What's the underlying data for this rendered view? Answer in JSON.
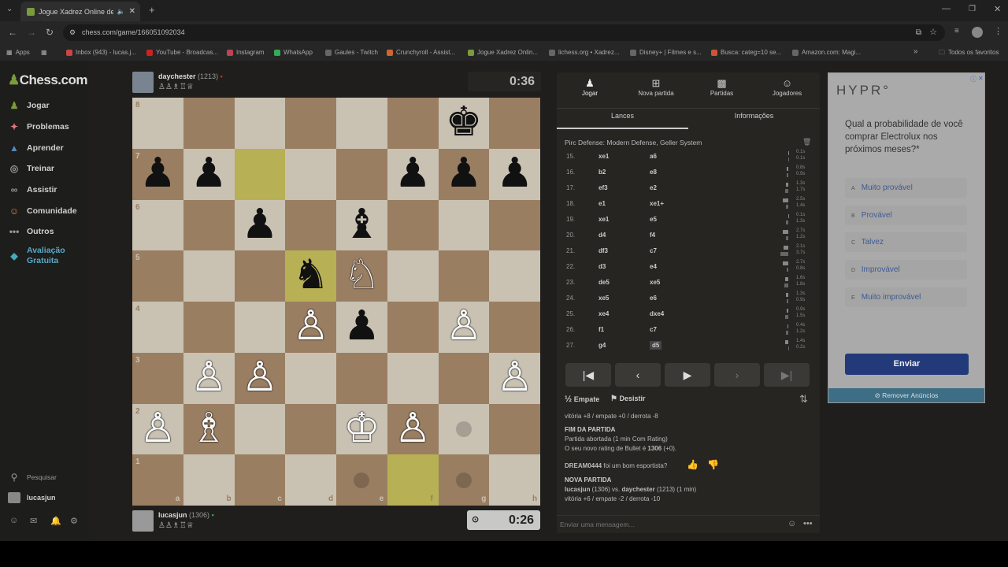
{
  "browser": {
    "tab_title": "Jogue Xadrez Online de Gr...",
    "url": "chess.com/game/166051092034",
    "bookmarks": [
      "Apps",
      "Inbox (943) - lucas.j...",
      "YouTube - Broadcas...",
      "Instagram",
      "WhatsApp",
      "Gaules - Twitch",
      "Crunchyroll - Assist...",
      "Jogue Xadrez Onlin...",
      "lichess.org • Xadrez...",
      "Disney+ | Filmes e s...",
      "Busca: categ=10 se...",
      "Amazon.com: Magi..."
    ],
    "bookmarks_folder": "Todos os favoritos"
  },
  "sidebar": {
    "logo": "Chess.com",
    "items": [
      {
        "label": "Jogar",
        "icon": "pawn-icon"
      },
      {
        "label": "Problemas",
        "icon": "puzzle-icon"
      },
      {
        "label": "Aprender",
        "icon": "graduation-icon"
      },
      {
        "label": "Treinar",
        "icon": "target-icon"
      },
      {
        "label": "Assistir",
        "icon": "binoculars-icon"
      },
      {
        "label": "Comunidade",
        "icon": "people-icon"
      },
      {
        "label": "Outros",
        "icon": "more-icon"
      },
      {
        "label": "Avaliação Gratuita",
        "icon": "diamond-icon"
      }
    ],
    "search_label": "Pesquisar",
    "user_label": "lucasjun"
  },
  "top_player": {
    "name": "daychester",
    "rating": "(1213)",
    "clock": "0:36"
  },
  "bottom_player": {
    "name": "lucasjun",
    "rating": "(1306)",
    "clock": "0:26"
  },
  "board": {
    "files": [
      "a",
      "b",
      "c",
      "d",
      "e",
      "f",
      "g",
      "h"
    ],
    "ranks": [
      "8",
      "7",
      "6",
      "5",
      "4",
      "3",
      "2",
      "1"
    ],
    "highlights": [
      "c7",
      "d5",
      "f1"
    ],
    "move_hints": [
      "g2",
      "e1",
      "g1"
    ],
    "pieces": [
      {
        "sq": "g8",
        "glyph": "♚",
        "color": "b"
      },
      {
        "sq": "a7",
        "glyph": "♟",
        "color": "b"
      },
      {
        "sq": "b7",
        "glyph": "♟",
        "color": "b"
      },
      {
        "sq": "f7",
        "glyph": "♟",
        "color": "b"
      },
      {
        "sq": "g7",
        "glyph": "♟",
        "color": "b"
      },
      {
        "sq": "h7",
        "glyph": "♟",
        "color": "b"
      },
      {
        "sq": "c6",
        "glyph": "♟",
        "color": "b"
      },
      {
        "sq": "e6",
        "glyph": "♝",
        "color": "b"
      },
      {
        "sq": "d5",
        "glyph": "♞",
        "color": "b"
      },
      {
        "sq": "e5",
        "glyph": "♘",
        "color": "w"
      },
      {
        "sq": "d4",
        "glyph": "♙",
        "color": "w"
      },
      {
        "sq": "e4",
        "glyph": "♟",
        "color": "b"
      },
      {
        "sq": "g4",
        "glyph": "♙",
        "color": "w"
      },
      {
        "sq": "b3",
        "glyph": "♙",
        "color": "w"
      },
      {
        "sq": "c3",
        "glyph": "♙",
        "color": "w"
      },
      {
        "sq": "h3",
        "glyph": "♙",
        "color": "w"
      },
      {
        "sq": "a2",
        "glyph": "♙",
        "color": "w"
      },
      {
        "sq": "b2",
        "glyph": "♗",
        "color": "w"
      },
      {
        "sq": "e2",
        "glyph": "♔",
        "color": "w"
      },
      {
        "sq": "f2",
        "glyph": "♙",
        "color": "w"
      }
    ]
  },
  "panel": {
    "top_tabs": [
      {
        "label": "Jogar",
        "icon": "pawn-icon"
      },
      {
        "label": "Nova partida",
        "icon": "plus-icon"
      },
      {
        "label": "Partidas",
        "icon": "board-icon"
      },
      {
        "label": "Jogadores",
        "icon": "people-icon"
      }
    ],
    "sub_tabs": [
      "Lances",
      "Informações"
    ],
    "opening": "Pirc Defense: Modern Defense, Geller System",
    "moves": [
      {
        "n": "15.",
        "w": "xe1",
        "b": "a6",
        "wt": "0.1s",
        "bt": "0.1s",
        "wf": 0.05,
        "bf": 0.05
      },
      {
        "n": "16.",
        "w": "b2",
        "b": "e8",
        "wt": "0.8s",
        "bt": "0.9s",
        "wf": 0.2,
        "bf": 0.2
      },
      {
        "n": "17.",
        "w": "ef3",
        "b": "e2",
        "wt": "1.3s",
        "bt": "1.7s",
        "wf": 0.3,
        "bf": 0.4
      },
      {
        "n": "18.",
        "w": "e1",
        "b": "xe1+",
        "wt": "2.5s",
        "bt": "1.4s",
        "wf": 0.7,
        "bf": 0.35
      },
      {
        "n": "19.",
        "w": "xe1",
        "b": "e5",
        "wt": "0.1s",
        "bt": "1.3s",
        "wf": 0.05,
        "bf": 0.3
      },
      {
        "n": "20.",
        "w": "d4",
        "b": "f4",
        "wt": "2.7s",
        "bt": "1.2s",
        "wf": 0.75,
        "bf": 0.3
      },
      {
        "n": "21.",
        "w": "df3",
        "b": "c7",
        "wt": "2.1s",
        "bt": "3.7s",
        "wf": 0.6,
        "bf": 1.0
      },
      {
        "n": "22.",
        "w": "d3",
        "b": "e4",
        "wt": "2.7s",
        "bt": "0.8s",
        "wf": 0.75,
        "bf": 0.2
      },
      {
        "n": "23.",
        "w": "de5",
        "b": "xe5",
        "wt": "1.6s",
        "bt": "1.8s",
        "wf": 0.45,
        "bf": 0.5
      },
      {
        "n": "24.",
        "w": "xe5",
        "b": "e6",
        "wt": "1.3s",
        "bt": "0.9s",
        "wf": 0.35,
        "bf": 0.25
      },
      {
        "n": "25.",
        "w": "xe4",
        "b": "dxe4",
        "wt": "0.9s",
        "bt": "1.5s",
        "wf": 0.25,
        "bf": 0.4
      },
      {
        "n": "26.",
        "w": "f1",
        "b": "c7",
        "wt": "0.4s",
        "bt": "1.2s",
        "wf": 0.1,
        "bf": 0.3
      },
      {
        "n": "27.",
        "w": "g4",
        "b": "d5",
        "wt": "1.4s",
        "bt": "0.2s",
        "wf": 0.4,
        "bf": 0.05
      }
    ],
    "nav": [
      "first",
      "prev",
      "play",
      "next",
      "last"
    ],
    "draw_label": "Empate",
    "resign_label": "Desistir",
    "chat": {
      "line1": "vitória +8 / empate +0 / derrota -8",
      "end_title": "FIM DA PARTIDA",
      "end_line1": "Partida abortada (1 min Com Rating)",
      "end_line2_prefix": "O seu novo rating de Bullet é ",
      "end_line2_rating": "1306",
      "end_line2_suffix": " (+0).",
      "sport_user": "DREAM0444",
      "sport_text": " foi um bom esportista?",
      "new_title": "NOVA PARTIDA",
      "new_p1": "lucasjun",
      "new_mid": " (1306) vs. ",
      "new_p2": "daychester",
      "new_suffix": " (1213) (1 min)",
      "new_line2": "vitória +6 / empate -2 / derrota -10",
      "placeholder": "Enviar uma mensagem..."
    }
  },
  "ad": {
    "brand": "HYPR°",
    "question": "Qual a probabilidade de você comprar Electrolux nos próximos meses?*",
    "options": [
      {
        "letter": "A",
        "label": "Muito provável"
      },
      {
        "letter": "B",
        "label": "Provável"
      },
      {
        "letter": "C",
        "label": "Talvez"
      },
      {
        "letter": "D",
        "label": "Improvável"
      },
      {
        "letter": "E",
        "label": "Muito improvável"
      }
    ],
    "submit": "Enviar",
    "remove": "Remover Anúncios"
  }
}
